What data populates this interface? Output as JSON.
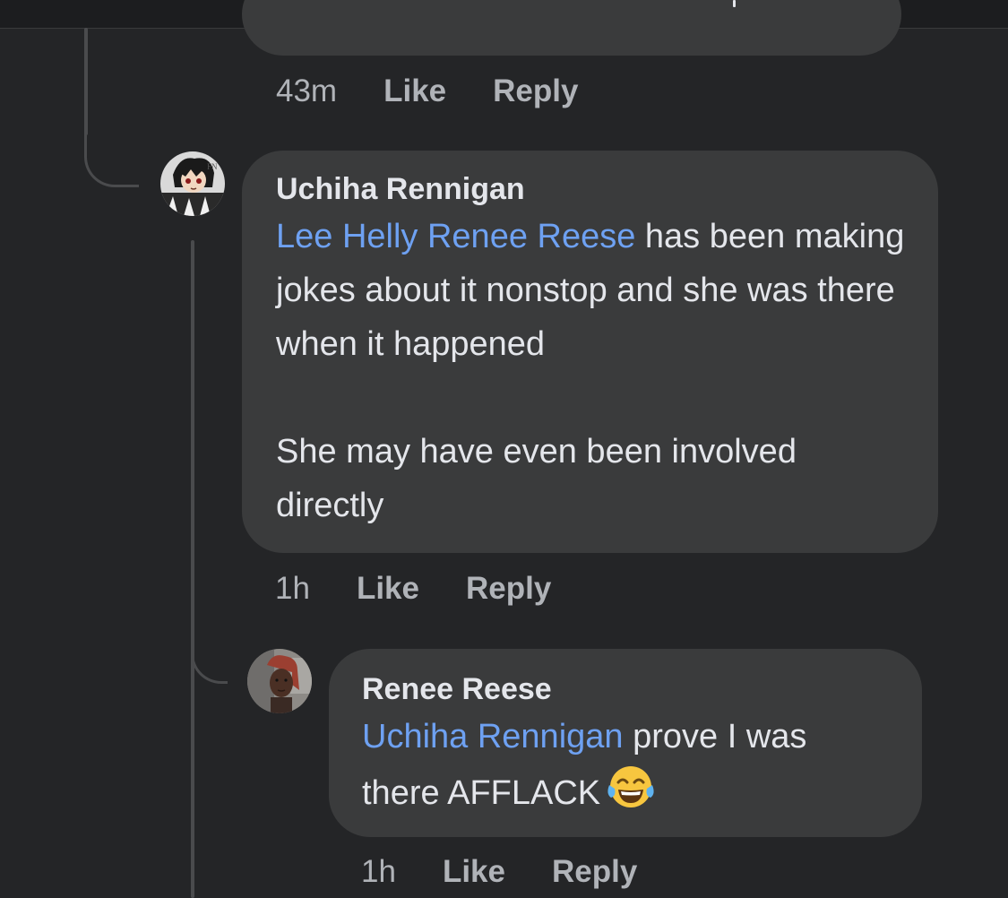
{
  "previous_comment": {
    "time": "43m",
    "like_label": "Like",
    "reply_label": "Reply"
  },
  "comment_1": {
    "author": "Uchiha Rennigan",
    "mention": "Lee Helly Renee Reese",
    "text_after_mention": " has been making jokes about it nonstop and she was there when it happened\n\nShe may have even been involved directly",
    "time": "1h",
    "like_label": "Like",
    "reply_label": "Reply",
    "avatar_icon": "anime-character-avatar"
  },
  "comment_2": {
    "author": "Renee Reese",
    "mention": "Uchiha Rennigan",
    "text_after_mention": " prove I was there AFFLACK",
    "emoji": "face-with-tears-of-joy",
    "time": "1h",
    "like_label": "Like",
    "reply_label": "Reply",
    "avatar_icon": "profile-photo-avatar"
  },
  "colors": {
    "background": "#242527",
    "bubble": "#3a3b3c",
    "mention": "#6ea1f2",
    "meta_text": "#b0b3b8"
  }
}
